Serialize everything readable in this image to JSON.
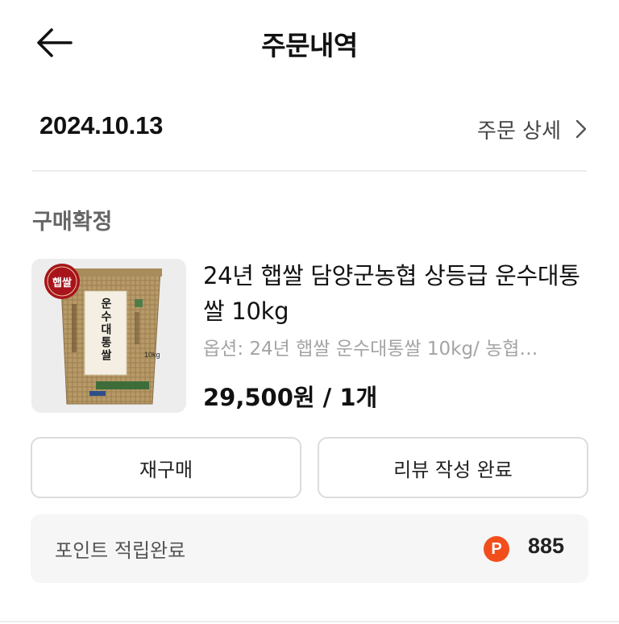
{
  "header": {
    "title": "주문내역",
    "back_icon": "arrow-left-icon"
  },
  "order": {
    "date": "2024.10.13",
    "detail_link_label": "주문 상세",
    "detail_icon": "chevron-right-icon",
    "status": "구매확정"
  },
  "product": {
    "title": "24년 햅쌀 담양군농협 상등급 운수대통쌀 10kg",
    "option": "옵션: 24년 햅쌀 운수대통쌀 10kg/ 농협…",
    "price": "29,500원 / 1개",
    "image_badge": "햅쌀",
    "image_bag_text": "운수대통쌀",
    "image_weight": "10kg"
  },
  "actions": {
    "rebuy_label": "재구매",
    "review_label": "리뷰 작성 완료"
  },
  "points": {
    "label": "포인트 적립완료",
    "icon_letter": "P",
    "value": "885"
  },
  "colors": {
    "accent_point": "#f14e1c",
    "badge_red": "#a8141c",
    "status_gray": "#666666"
  }
}
